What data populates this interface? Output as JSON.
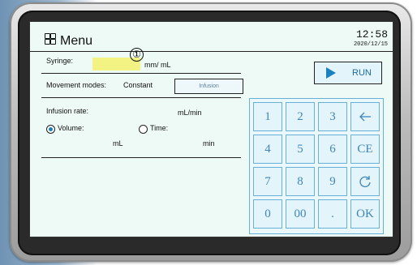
{
  "header": {
    "menu_label": "Menu",
    "time": "12:58",
    "date": "2020/12/15"
  },
  "annotation": {
    "marker": "①"
  },
  "syringe": {
    "label": "Syringe:",
    "unit": "mm/ mL"
  },
  "movement": {
    "label": "Movement modes:",
    "value": "Constant",
    "button_label": "Infusion"
  },
  "infusion_rate": {
    "label": "Infusion rate:",
    "unit": "mL/min"
  },
  "volume_option": {
    "label": "Volume:",
    "unit": "mL",
    "selected": true
  },
  "time_option": {
    "label": "Time:",
    "unit": "min",
    "selected": false
  },
  "run": {
    "label": "RUN"
  },
  "keypad": {
    "k1": "1",
    "k2": "2",
    "k3": "3",
    "back_icon": "backspace-arrow-icon",
    "k4": "4",
    "k5": "5",
    "k6": "6",
    "clear": "CE",
    "k7": "7",
    "k8": "8",
    "k9": "9",
    "reset_icon": "refresh-icon",
    "k0": "0",
    "k00": "00",
    "dot": ".",
    "ok": "OK"
  },
  "colors": {
    "accent": "#1a80c0",
    "screen_bg": "#eefaf5",
    "syringe_field": "#f3f383",
    "key_border": "#69b0d6"
  }
}
